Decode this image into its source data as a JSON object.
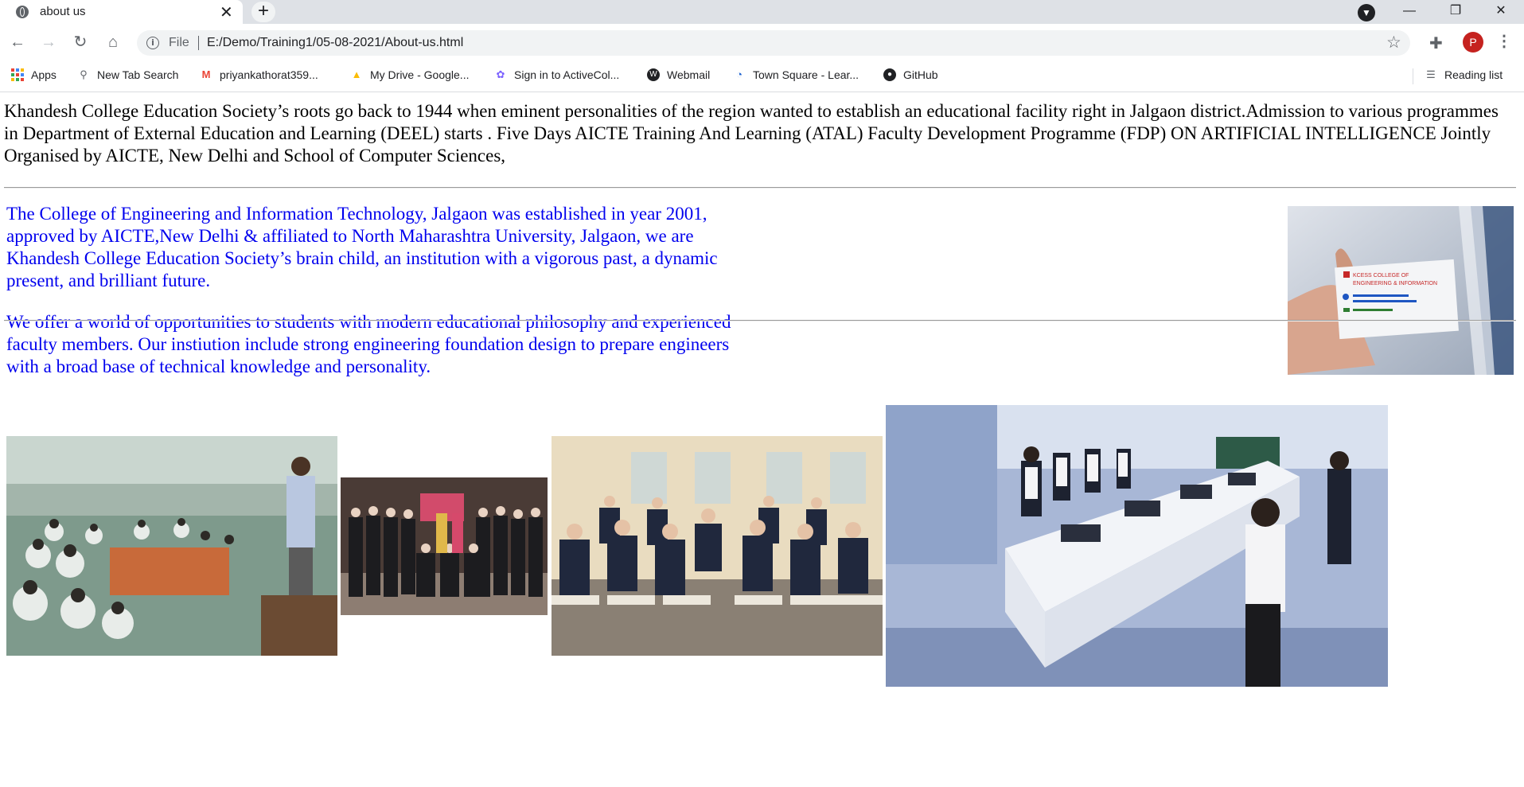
{
  "browser": {
    "tab_title": "about us",
    "address_scheme_label": "File",
    "url": "E:/Demo/Training1/05-08-2021/About-us.html",
    "profile_initial": "P",
    "bookmarks": [
      {
        "label": "Apps",
        "icon": "apps-grid-icon"
      },
      {
        "label": "New Tab Search",
        "icon": "search-icon"
      },
      {
        "label": "priyankathorat359...",
        "icon": "gmail-icon"
      },
      {
        "label": "My Drive - Google...",
        "icon": "google-drive-icon"
      },
      {
        "label": "Sign in to ActiveCol...",
        "icon": "activecollab-icon"
      },
      {
        "label": "Webmail",
        "icon": "webmail-icon"
      },
      {
        "label": "Town Square - Lear...",
        "icon": "town-square-icon"
      },
      {
        "label": "GitHub",
        "icon": "github-icon"
      }
    ],
    "reading_list_label": "Reading list",
    "colors": {
      "tabstrip": "#dee1e6",
      "omnibox": "#f1f3f4",
      "profile": "#c5221f"
    }
  },
  "page": {
    "intro": "Khandesh College Education Society’s roots go back to 1944 when eminent personalities of the region wanted to establish an educational facility right in Jalgaon district.Admission to various programmes in Department of External Education and Learning (DEEL) starts . Five Days AICTE Training And Learning (ATAL) Faculty Development Programme (FDP) ON ARTIFICIAL INTELLIGENCE Jointly Organised by AICTE, New Delhi and School of Computer Sciences,",
    "para1": "The College of Engineering and Information Technology, Jalgaon was established in year 2001, approved by AICTE,New Delhi & affiliated to North Maharashtra University, Jalgaon, we are Khandesh College Education Society’s brain child, an institution with a vigorous past, a dynamic present, and brilliant future.",
    "para2": "We offer a world of opportunities to students with modern educational philosophy and experienced faculty members. Our instiution include strong engineering foundation design to prepare engineers with a broad base of technical knowledge and personality.",
    "text_color": "#0000ee",
    "card_image": {
      "card_line1": "KCESS COLLEGE OF",
      "card_line2": "ENGINEERING & INFORMATION"
    },
    "gallery": [
      "seminar-hall-photo",
      "group-photo",
      "classroom-photo",
      "electronics-lab-photo"
    ]
  }
}
